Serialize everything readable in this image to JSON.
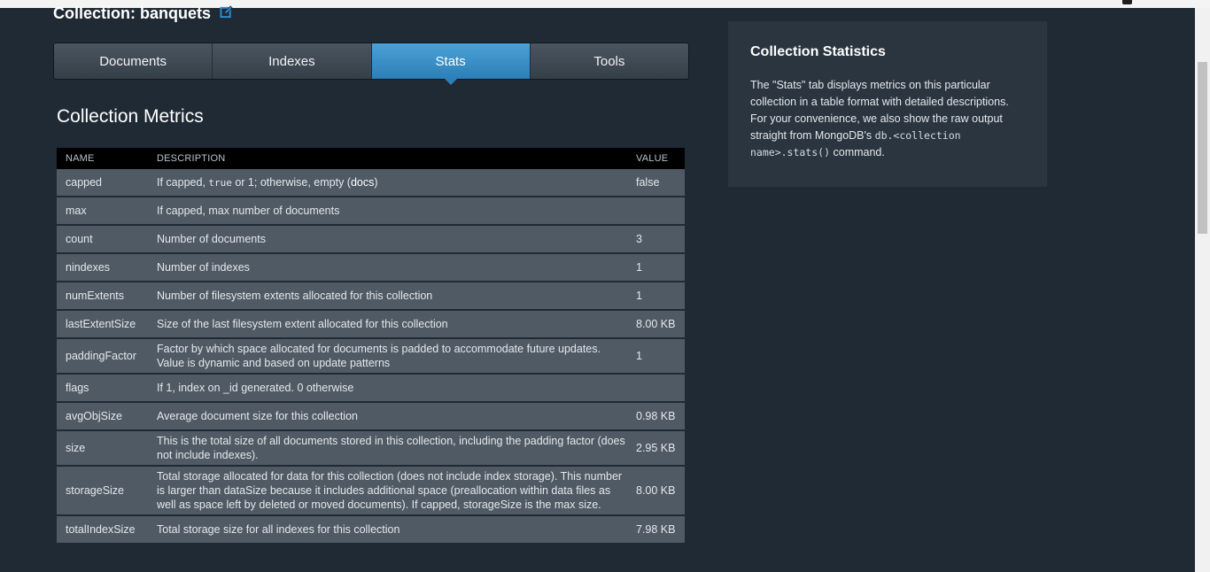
{
  "header": {
    "title": "Collection: banquets",
    "edit_icon": "edit-icon",
    "accent_color": "#2d8fd5"
  },
  "tabs": [
    {
      "label": "Documents",
      "active": false
    },
    {
      "label": "Indexes",
      "active": false
    },
    {
      "label": "Stats",
      "active": true
    },
    {
      "label": "Tools",
      "active": false
    }
  ],
  "metrics": {
    "heading": "Collection Metrics",
    "columns": [
      "NAME",
      "DESCRIPTION",
      "VALUE"
    ],
    "rows": [
      {
        "name": "capped",
        "desc_pre": "If capped, ",
        "desc_code": "true",
        "desc_mid": " or 1; otherwise, empty (",
        "desc_link": "docs",
        "desc_post": ")",
        "value": "false"
      },
      {
        "name": "max",
        "description": "If capped, max number of documents",
        "value": ""
      },
      {
        "name": "count",
        "description": "Number of documents",
        "value": "3"
      },
      {
        "name": "nindexes",
        "description": "Number of indexes",
        "value": "1"
      },
      {
        "name": "numExtents",
        "description": "Number of filesystem extents allocated for this collection",
        "value": "1"
      },
      {
        "name": "lastExtentSize",
        "description": "Size of the last filesystem extent allocated for this collection",
        "value": "8.00 KB"
      },
      {
        "name": "paddingFactor",
        "description": "Factor by which space allocated for documents is padded to accommodate future updates. Value is dynamic and based on update patterns",
        "value": "1"
      },
      {
        "name": "flags",
        "description": "If 1, index on _id generated. 0 otherwise",
        "value": ""
      },
      {
        "name": "avgObjSize",
        "description": "Average document size for this collection",
        "value": "0.98 KB"
      },
      {
        "name": "size",
        "description": "This is the total size of all documents stored in this collection, including the padding factor (does not include indexes).",
        "value": "2.95 KB"
      },
      {
        "name": "storageSize",
        "description": "Total storage allocated for data for this collection (does not include index storage). This number is larger than dataSize because it includes additional space (preallocation within data files as well as space left by deleted or moved documents). If capped, storageSize is the max size.",
        "value": "8.00 KB"
      },
      {
        "name": "totalIndexSize",
        "description": "Total storage size for all indexes for this collection",
        "value": "7.98 KB"
      }
    ]
  },
  "sidebar": {
    "title": "Collection Statistics",
    "text_pre": "The \"Stats\" tab displays metrics on this particular collection in a table format with detailed descriptions. For your convenience, we also show the raw output straight from MongoDB's ",
    "code": "db.<collection name>.stats()",
    "text_post": " command."
  }
}
